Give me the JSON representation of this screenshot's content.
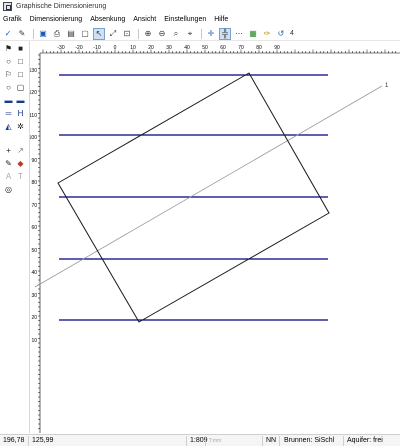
{
  "window": {
    "title": "Graphische Dimensionierung"
  },
  "menu": [
    "Grafik",
    "Dimensionierung",
    "Absenkung",
    "Ansicht",
    "Einstellungen",
    "Hilfe"
  ],
  "toolbar": {
    "count_label": "4"
  },
  "ruler": {
    "x_ticks": [
      "-30",
      "-20",
      "-10",
      "0",
      "10",
      "20",
      "30",
      "40",
      "50",
      "60",
      "70",
      "80",
      "90"
    ],
    "y_ticks": [
      "130",
      "120",
      "110",
      "100",
      "90",
      "80",
      "70",
      "60",
      "50",
      "40",
      "30",
      "20",
      "10"
    ]
  },
  "drawing": {
    "line_label": "1",
    "line_color": "#000080"
  },
  "status": {
    "x": "196,78",
    "y": "125,99",
    "scale": "1:809",
    "time": "T:mm",
    "datum": "NN",
    "well": "Brunnen: SiSchl",
    "aquifer": "Aquifer: frei"
  }
}
